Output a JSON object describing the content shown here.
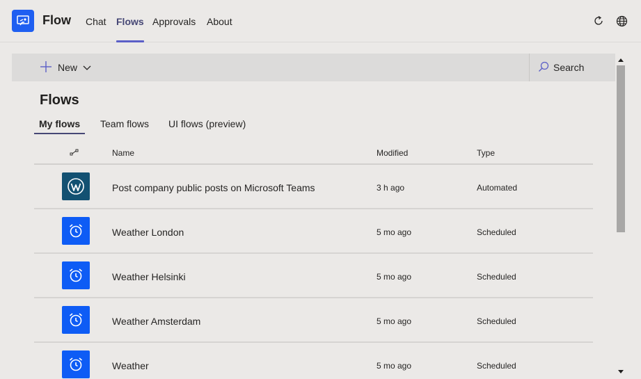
{
  "app": {
    "name": "Flow"
  },
  "nav": {
    "tabs": [
      {
        "label": "Chat"
      },
      {
        "label": "Flows"
      },
      {
        "label": "Approvals"
      },
      {
        "label": "About"
      }
    ],
    "active_tab": "Flows"
  },
  "header_icons": [
    "refresh-icon",
    "globe-icon"
  ],
  "command_bar": {
    "new_label": "New",
    "search_label": "Search"
  },
  "page": {
    "title": "Flows",
    "sub_tabs": [
      {
        "label": "My flows"
      },
      {
        "label": "Team flows"
      },
      {
        "label": "UI flows (preview)"
      }
    ],
    "active_sub_tab": "My flows"
  },
  "table": {
    "columns": [
      "Name",
      "Modified",
      "Type"
    ],
    "rows": [
      {
        "icon": "wordpress-icon",
        "name": "Post company public posts on Microsoft Teams",
        "modified": "3 h ago",
        "type": "Automated"
      },
      {
        "icon": "alarm-clock-icon",
        "name": "Weather London",
        "modified": "5 mo ago",
        "type": "Scheduled"
      },
      {
        "icon": "alarm-clock-icon",
        "name": "Weather Helsinki",
        "modified": "5 mo ago",
        "type": "Scheduled"
      },
      {
        "icon": "alarm-clock-icon",
        "name": "Weather Amsterdam",
        "modified": "5 mo ago",
        "type": "Scheduled"
      },
      {
        "icon": "alarm-clock-icon",
        "name": "Weather",
        "modified": "5 mo ago",
        "type": "Scheduled"
      }
    ]
  },
  "colors": {
    "accent": "#464775",
    "app_icon": "#1f5ff1",
    "wordpress_tile": "#135172",
    "schedule_tile": "#0e5cf5"
  }
}
